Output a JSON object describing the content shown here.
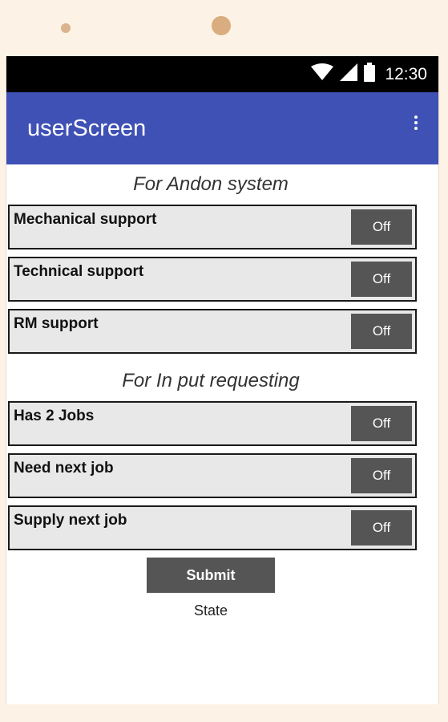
{
  "status_bar": {
    "time": "12:30"
  },
  "app_bar": {
    "title": "userScreen"
  },
  "sections": [
    {
      "title": "For Andon system",
      "rows": [
        {
          "label": "Mechanical support",
          "toggle": "Off"
        },
        {
          "label": "Technical support",
          "toggle": "Off"
        },
        {
          "label": "RM support",
          "toggle": "Off"
        }
      ]
    },
    {
      "title": "For In put requesting",
      "rows": [
        {
          "label": "Has 2 Jobs",
          "toggle": "Off"
        },
        {
          "label": "Need next job",
          "toggle": "Off"
        },
        {
          "label": "Supply next job",
          "toggle": "Off"
        }
      ]
    }
  ],
  "submit": {
    "label": "Submit"
  },
  "state": {
    "label": "State"
  },
  "colors": {
    "app_bar": "#3f51b5",
    "status_bar": "#000000",
    "button": "#555555",
    "row_background": "#e8e8e8",
    "frame": "#fdf2e6"
  },
  "icons": [
    "wifi-icon",
    "cell-signal-icon",
    "battery-icon",
    "overflow-menu-icon"
  ]
}
